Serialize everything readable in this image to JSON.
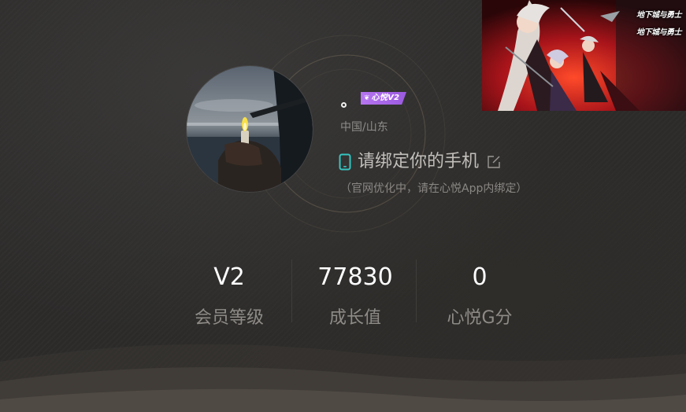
{
  "profile": {
    "username": "",
    "vip_badge": "心悦V2",
    "location": "中国/山东",
    "bind_phone_text": "请绑定你的手机",
    "bind_phone_note": "（官网优化中，请在心悦App内绑定）"
  },
  "stats": [
    {
      "value": "V2",
      "label": "会员等级"
    },
    {
      "value": "77830",
      "label": "成长值"
    },
    {
      "value": "0",
      "label": "心悦G分"
    }
  ],
  "ad": {
    "logo_text": "地下城与勇士"
  },
  "colors": {
    "accent_teal": "#35c6c0",
    "vip_purple": "#a865e8",
    "background": "#2b2a29"
  },
  "icons": {
    "phone": "phone-icon",
    "edit": "edit-icon",
    "vip_wings": "wing-icon"
  }
}
